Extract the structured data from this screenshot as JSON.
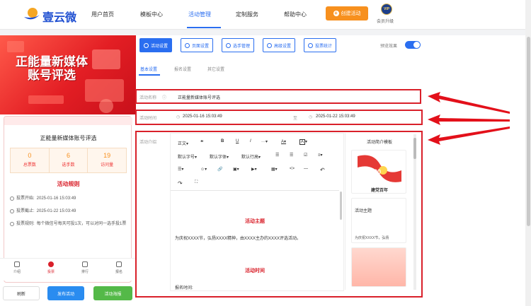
{
  "brand": {
    "name": "壹云微"
  },
  "nav": {
    "items": [
      "用户首页",
      "模板中心",
      "活动管理",
      "定制服务",
      "帮助中心"
    ],
    "create_button": "创建活动",
    "vip_badge": "VIP",
    "vip_label": "会员升级"
  },
  "preview": {
    "banner_title": "正能量新媒体账号评选",
    "card_title": "正能量新媒体账号评选",
    "stats": [
      {
        "value": "0",
        "label": "总票数"
      },
      {
        "value": "6",
        "label": "选手数"
      },
      {
        "value": "19",
        "label": "访问量"
      }
    ],
    "rules_title": "活动规则",
    "rules": [
      {
        "label": "投票开始:",
        "text": "2025-01-16 15:03:49"
      },
      {
        "label": "投票截止:",
        "text": "2025-01-22 15:03:49"
      },
      {
        "label": "投票规则:",
        "text": "每个微信号每天可投1次，可以对同一选手投1票"
      }
    ],
    "tabs": [
      "介绍",
      "投票",
      "排行",
      "报名"
    ],
    "buttons": {
      "refresh": "刷新",
      "publish": "发布活动",
      "poster": "活动海报"
    }
  },
  "toolbar": {
    "buttons": [
      "活动设置",
      "页面设置",
      "选手管理",
      "高级设置",
      "投票统计"
    ],
    "preview_label": "预览效果"
  },
  "subtabs": [
    "基本设置",
    "报名设置",
    "其它设置"
  ],
  "form": {
    "name_label": "活动名称",
    "name_value": "正能量新媒体账号评选",
    "time_label": "活动时间",
    "start_time": "2025-01-16 15:03:49",
    "separator": "至",
    "end_time": "2025-01-22 15:03:49",
    "intro_label": "活动介绍"
  },
  "editor": {
    "tools_row1": [
      "正文",
      "❝",
      "B",
      "U",
      "I",
      "···",
      "A",
      "A"
    ],
    "tools_row2": [
      "默认字号",
      "默认字体",
      "默认行高",
      "☰",
      "☰",
      "☑",
      "≡"
    ],
    "tools_row3": [
      "☰",
      "☺",
      "🔗",
      "▣",
      "▶",
      "▦",
      "<>",
      "—",
      "↶"
    ],
    "tools_row4": [
      "↷",
      "⛶"
    ],
    "heading1": "活动主题",
    "paragraph1": "为庆祝XXXX节，弘扬XXXX精神，由XXXX主办的XXXX评选活动。",
    "heading2": "活动时间",
    "paragraph2": "报名时间:"
  },
  "templates": {
    "title": "活动简介模板",
    "card1_text": "建党百年",
    "card2_title": "活动主题",
    "card2_text": "为庆祝XXXX节，弘扬"
  }
}
